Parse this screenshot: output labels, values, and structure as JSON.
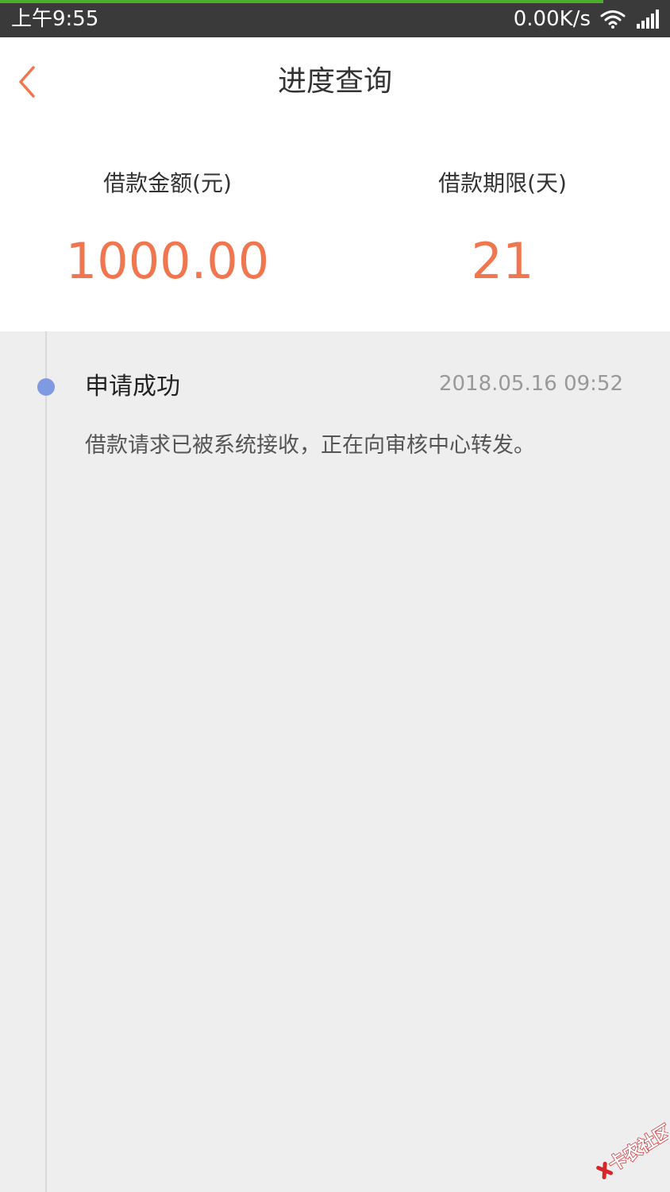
{
  "status_bar": {
    "time": "上午9:55",
    "network_speed": "0.00K/s",
    "load_progress": 0.9,
    "wifi_icon": "wifi-icon",
    "signal_icon": "signal-icon"
  },
  "header": {
    "back_icon": "chevron-left-icon",
    "title": "进度查询"
  },
  "summary": {
    "amount_label": "借款金额(元)",
    "amount_value": "1000.00",
    "term_label": "借款期限(天)",
    "term_value": "21"
  },
  "timeline": {
    "events": [
      {
        "title": "申请成功",
        "time": "2018.05.16 09:52",
        "description": "借款请求已被系统接收，正在向审核中心转发。"
      }
    ]
  },
  "watermark": {
    "text": "卡农社区"
  },
  "colors": {
    "accent": "#f07650",
    "status_bar": "#3a3a3a",
    "progress": "#4caf2a",
    "timeline_dot": "#7f9ae0",
    "background": "#eeeeee"
  }
}
